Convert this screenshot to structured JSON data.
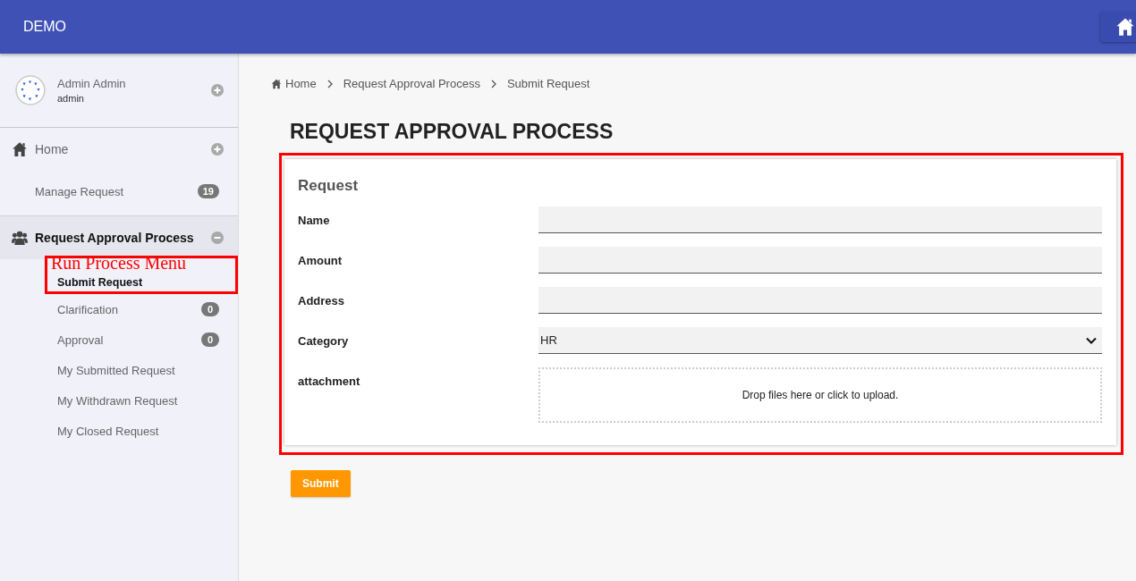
{
  "header": {
    "title": "DEMO"
  },
  "user": {
    "name": "Admin Admin",
    "username": "admin"
  },
  "menu": [
    {
      "label": "Home",
      "expanded": false,
      "children": [
        {
          "label": "Manage Request",
          "badge": "19",
          "selected": false
        }
      ]
    },
    {
      "label": "Request Approval Process",
      "expanded": true,
      "children": [
        {
          "label": "Submit Request",
          "selected": true
        },
        {
          "label": "Clarification",
          "badge": "0",
          "selected": false
        },
        {
          "label": "Approval",
          "badge": "0",
          "selected": false
        },
        {
          "label": "My Submitted Request",
          "selected": false
        },
        {
          "label": "My Withdrawn Request",
          "selected": false
        },
        {
          "label": "My Closed Request",
          "selected": false
        }
      ]
    }
  ],
  "breadcrumb": [
    "Home",
    "Request Approval Process",
    "Submit Request"
  ],
  "page_title": "REQUEST APPROVAL PROCESS",
  "form": {
    "title": "Request",
    "fields": [
      {
        "label": "Name",
        "kind": "text"
      },
      {
        "label": "Amount",
        "kind": "text"
      },
      {
        "label": "Address",
        "kind": "text"
      },
      {
        "label": "Category",
        "kind": "select",
        "value": "HR"
      },
      {
        "label": "attachment",
        "kind": "file",
        "placeholder": "Drop files here or click to upload."
      }
    ]
  },
  "submit": "Submit",
  "annotations": [
    {
      "kind": "menu",
      "text": "Run Process Menu"
    },
    {
      "kind": "form"
    }
  ]
}
